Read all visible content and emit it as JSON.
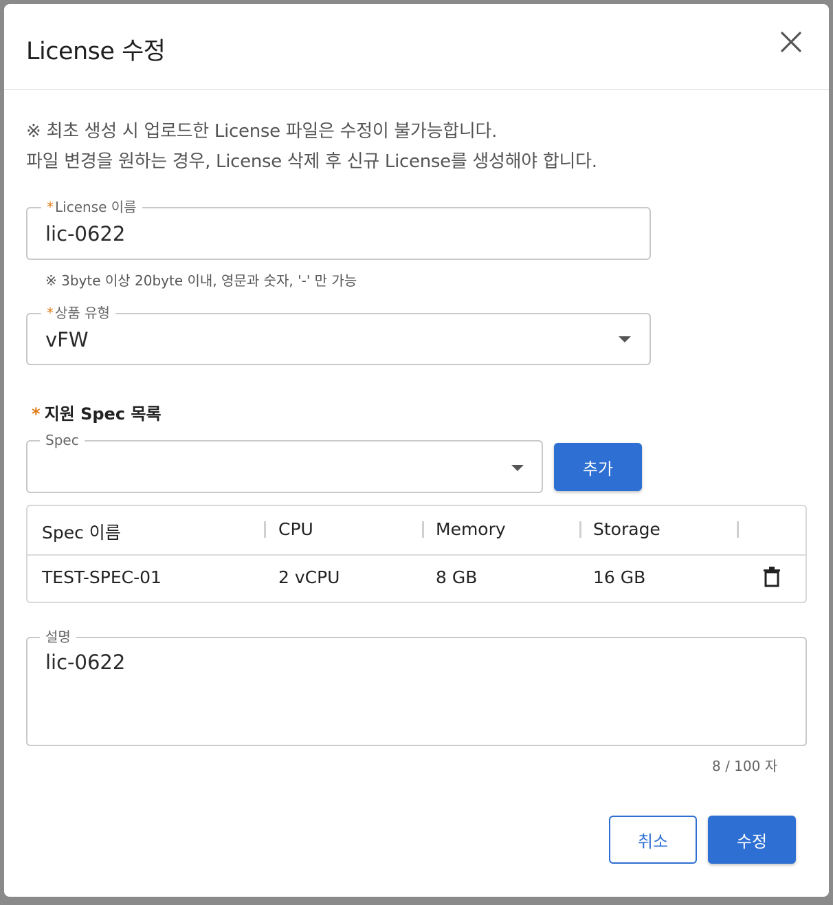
{
  "dialog": {
    "title": "License 수정",
    "notice_line1": "※ 최초 생성 시 업로드한 License 파일은 수정이 불가능합니다.",
    "notice_line2": "파일 변경을 원하는 경우, License 삭제 후 신규 License를 생성해야 합니다."
  },
  "license_name": {
    "required_mark": "*",
    "label": "License 이름",
    "value": "lic-0622",
    "hint": "※ 3byte 이상 20byte 이내, 영문과 숫자, '-' 만 가능"
  },
  "product_type": {
    "required_mark": "*",
    "label": "상품 유형",
    "value": "vFW"
  },
  "spec_section": {
    "required_mark": "*",
    "title": "지원 Spec 목록",
    "select_label": "Spec",
    "select_value": "",
    "add_button": "추가"
  },
  "spec_table": {
    "columns": [
      "Spec 이름",
      "CPU",
      "Memory",
      "Storage"
    ],
    "rows": [
      {
        "name": "TEST-SPEC-01",
        "cpu": "2 vCPU",
        "memory": "8 GB",
        "storage": "16 GB"
      }
    ]
  },
  "description": {
    "label": "설명",
    "value": "lic-0622",
    "counter": "8 / 100 자"
  },
  "footer": {
    "cancel_button": "취소",
    "submit_button": "수정"
  },
  "colors": {
    "primary": "#2d6fd2",
    "required": "#e07b16"
  },
  "icons": [
    "close-icon",
    "dropdown-caret-icon",
    "trash-icon"
  ]
}
